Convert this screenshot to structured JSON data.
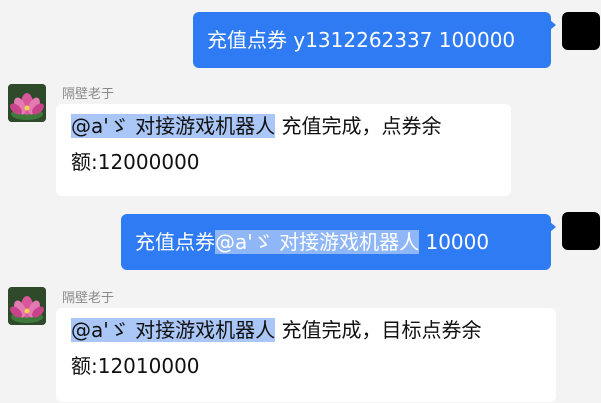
{
  "messages": [
    {
      "direction": "outgoing",
      "text": "充值点券 y1312262337 100000"
    },
    {
      "direction": "incoming",
      "sender": "隔壁老于",
      "mention": "@a'ゞ 对接游戏机器人",
      "line1_rest": " 充值完成，点券余",
      "line2": "额:12000000"
    },
    {
      "direction": "outgoing",
      "prefix": "充值点券",
      "mention": "@a'ゞ 对接游戏机器人",
      "suffix": " 10000"
    },
    {
      "direction": "incoming",
      "sender": "隔壁老于",
      "mention": "@a'ゞ 对接游戏机器人",
      "line1_rest": " 充值完成，目标点券余",
      "line2": "额:12010000"
    }
  ],
  "icons": {
    "self_avatar": "black-square-avatar",
    "other_avatar": "lotus-flower-avatar"
  },
  "colors": {
    "outgoing_bubble": "#2f7bf3",
    "incoming_bubble": "#ffffff",
    "mention_highlight": "#a9c6f6",
    "background": "#f3f3f3"
  }
}
